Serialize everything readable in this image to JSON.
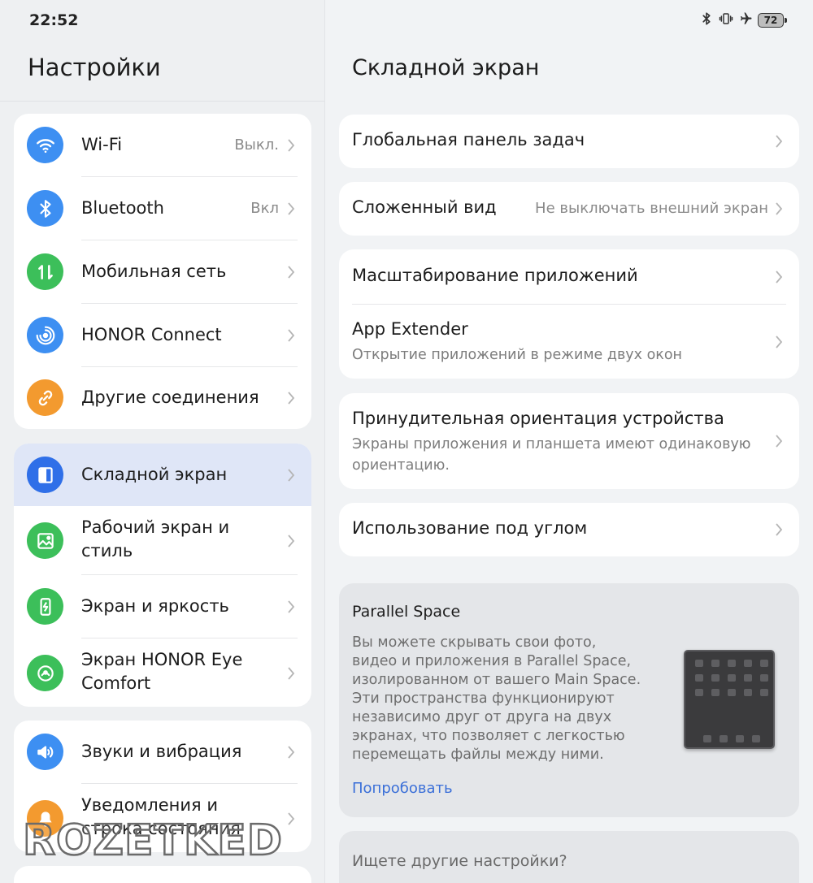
{
  "status_bar": {
    "time": "22:52",
    "battery": "72"
  },
  "left_panel": {
    "title": "Настройки",
    "groups": [
      [
        {
          "label": "Wi-Fi",
          "value": "Выкл.",
          "icon": "wifi-icon",
          "color": "#3d8ff2"
        },
        {
          "label": "Bluetooth",
          "value": "Вкл",
          "icon": "bluetooth-icon",
          "color": "#3d8ff2"
        },
        {
          "label": "Мобильная сеть",
          "value": "",
          "icon": "mobile-data-icon",
          "color": "#3cbf5a"
        },
        {
          "label": "HONOR Connect",
          "value": "",
          "icon": "honor-connect-icon",
          "color": "#3d8ff2"
        },
        {
          "label": "Другие соединения",
          "value": "",
          "icon": "link-icon",
          "color": "#f39a2f"
        }
      ],
      [
        {
          "label": "Складной экран",
          "value": "",
          "icon": "foldable-screen-icon",
          "color": "#2f6fe8",
          "active": true
        },
        {
          "label": "Рабочий экран и\nстиль",
          "value": "",
          "icon": "image-icon",
          "color": "#3cbf5a"
        },
        {
          "label": "Экран и яркость",
          "value": "",
          "icon": "brightness-icon",
          "color": "#3cbf5a"
        },
        {
          "label": "Экран HONOR Eye\nComfort",
          "value": "",
          "icon": "eye-comfort-icon",
          "color": "#3cbf5a"
        }
      ],
      [
        {
          "label": "Звуки и вибрация",
          "value": "",
          "icon": "sound-icon",
          "color": "#3d8ff2"
        },
        {
          "label": "Уведомления и\nстрока состояния",
          "value": "",
          "icon": "notification-icon",
          "color": "#f39a2f"
        }
      ]
    ]
  },
  "right_panel": {
    "title": "Складной экран",
    "items": {
      "global_taskbar": "Глобальная панель задач",
      "folded_view": "Сложенный вид",
      "folded_view_value": "Не выключать внешний экран",
      "app_scaling": "Масштабирование приложений",
      "app_extender": "App Extender",
      "app_extender_sub": "Открытие приложений в режиме двух окон",
      "forced_orientation": "Принудительная ориентация устройства",
      "forced_orientation_sub": "Экраны приложения и планшета имеют одинаковую\nориентацию.",
      "angle_use": "Использование под углом"
    },
    "promo": {
      "title": "Parallel Space",
      "text": "Вы можете скрывать свои фото,\nвидео и приложения в Parallel Space,\nизолированном от вашего Main Space.\nЭти пространства функционируют\nнезависимо друг от друга на двух\nэкранах, что позволяет с легкостью\nперемещать файлы между ними.",
      "link": "Попробовать"
    },
    "search_prompt": "Ищете другие настройки?"
  },
  "watermark": "ROZETKED"
}
